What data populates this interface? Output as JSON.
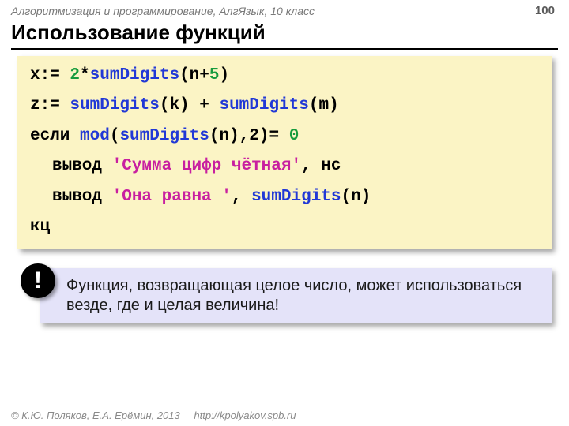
{
  "header": {
    "course": "Алгоритмизация и программирование, АлгЯзык, 10 класс",
    "slide_number": "100"
  },
  "title": "Использование функций",
  "code": {
    "l1_a": "x:=",
    "l1_b": "2",
    "l1_c": "*",
    "l1_d": "sumDigits",
    "l1_e": "(n+",
    "l1_f": "5",
    "l1_g": ")",
    "l2_a": "z:=",
    "l2_b": "sumDigits",
    "l2_c": "(k) +",
    "l2_d": "sumDigits",
    "l2_e": "(m)",
    "l3_a": "если",
    "l3_b": "mod",
    "l3_c": "(",
    "l3_d": "sumDigits",
    "l3_e": "(n),2)=",
    "l3_f": "0",
    "l4_a": "вывод",
    "l4_b": "'Сумма цифр чётная'",
    "l4_c": ", нс",
    "l5_a": "вывод",
    "l5_b": "'Она равна '",
    "l5_c": ",",
    "l5_d": "sumDigits",
    "l5_e": "(n)",
    "l6_a": "кц"
  },
  "note": {
    "badge": "!",
    "text": "Функция, возвращающая целое число, может использоваться везде, где и целая величина!"
  },
  "footer": {
    "copyright": "© К.Ю. Поляков, Е.А. Ерёмин, 2013",
    "link": "http://kpolyakov.spb.ru"
  }
}
